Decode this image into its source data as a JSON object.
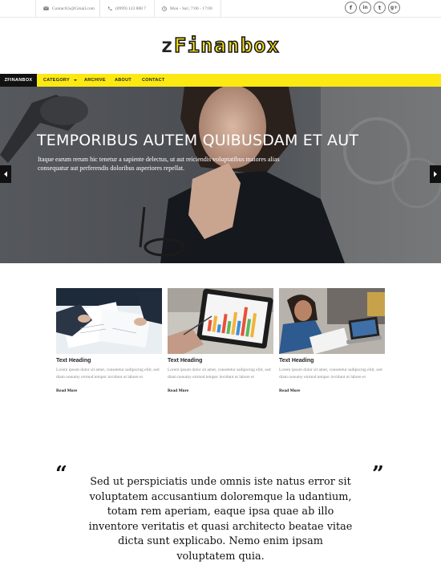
{
  "topbar": {
    "email": "ContactUs@Gmail.com",
    "phone": "(8999) 123 888 7",
    "hours": "Mon - Sat | 7:00 - 17:00",
    "socials": [
      {
        "icon": "facebook-icon",
        "glyph": "f"
      },
      {
        "icon": "linkedin-icon",
        "glyph": "in"
      },
      {
        "icon": "twitter-icon",
        "glyph": "t"
      },
      {
        "icon": "google-plus-icon",
        "glyph": "g+"
      }
    ]
  },
  "logo": {
    "first": "z",
    "rest": "Finanbox"
  },
  "nav": {
    "brand": "ZFINANBOX",
    "items": [
      "CATEGORY",
      "ARCHIVE",
      "ABOUT",
      "CONTACT"
    ]
  },
  "hero": {
    "title": "TEMPORIBUS AUTEM QUIBUSDAM ET AUT",
    "text": "Itaque earum rerum hic tenetur a sapiente delectus, ut aut reiciendis voluptatibus maiores alias consequatur aut perferendis doloribus asperiores repellat."
  },
  "cards": [
    {
      "heading": "Text Heading",
      "text": "Lorem ipsum dolor sit amet, consetetur sadipscing elitr, sed diam nonumy eirmod tempor invidunt ut labore et",
      "link": "Read More"
    },
    {
      "heading": "Text Heading",
      "text": "Lorem ipsum dolor sit amet, consetetur sadipscing elitr, sed diam nonumy eirmod tempor invidunt ut labore et",
      "link": "Read More"
    },
    {
      "heading": "Text Heading",
      "text": "Lorem ipsum dolor sit amet, consetetur sadipscing elitr, sed diam nonumy eirmod tempor invidunt ut labore et",
      "link": "Read More"
    }
  ],
  "quote": {
    "open": "“",
    "close": "”",
    "text": "Sed ut perspiciatis unde omnis iste natus error sit voluptatem accusantium doloremque la udantium, totam rem aperiam, eaque ipsa quae ab illo inventore veritatis et quasi architecto beatae vitae dicta sunt explicabo. Nemo enim ipsam voluptatem quia."
  },
  "colors": {
    "accent": "#fce914",
    "dark": "#111111"
  }
}
